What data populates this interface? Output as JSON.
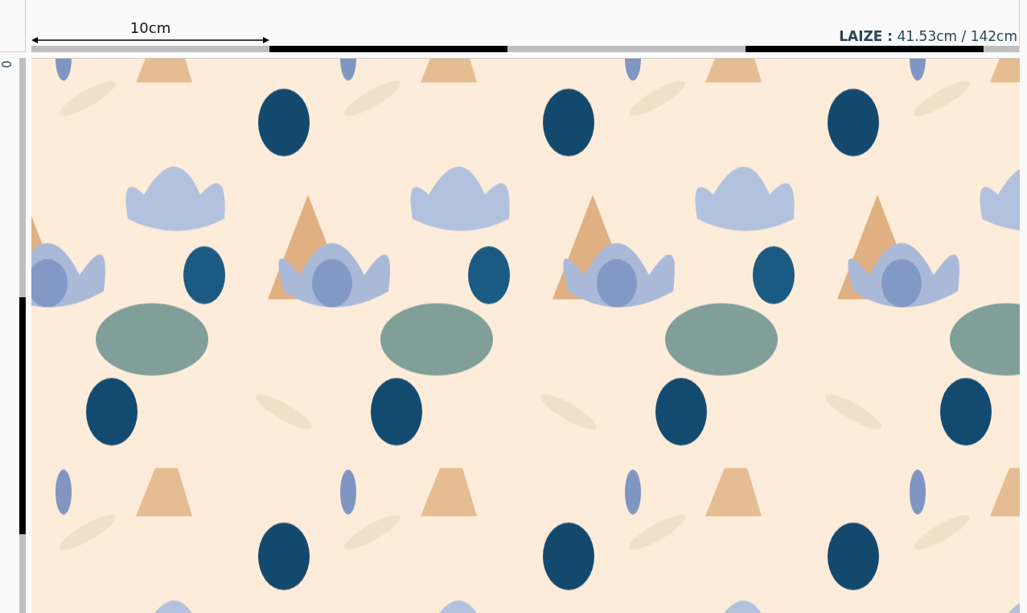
{
  "scale": {
    "label": "10cm"
  },
  "width_info": {
    "text": "**LAIZE :** 41.53cm / 142cm"
  },
  "vertical_ruler": {
    "origin": "0"
  }
}
